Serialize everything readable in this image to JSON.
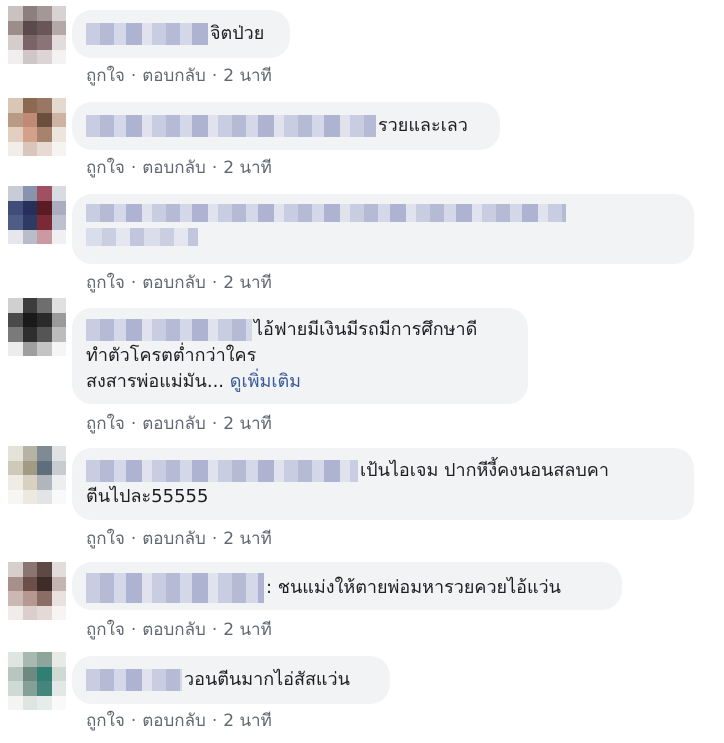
{
  "comments": [
    {
      "text": "จิตป่วย",
      "actions": {
        "like": "ถูกใจ",
        "reply": "ตอบกลับ",
        "time": "2 นาที"
      }
    },
    {
      "text": "รวยและเลว",
      "actions": {
        "like": "ถูกใจ",
        "reply": "ตอบกลับ",
        "time": "2 นาที"
      }
    },
    {
      "text": "",
      "actions": {
        "like": "ถูกใจ",
        "reply": "ตอบกลับ",
        "time": "2 นาที"
      }
    },
    {
      "text_line1": "ไอ้ฟายมีเงินมีรถมีการศึกษาดี",
      "text_line2": "ทำตัวโครตต่ำกว่าใคร",
      "text_line3": "สงสารพ่อแม่มัน...",
      "see_more": "ดูเพิ่มเติม",
      "actions": {
        "like": "ถูกใจ",
        "reply": "ตอบกลับ",
        "time": "2 นาที"
      }
    },
    {
      "text_line1": "เป้นไอเจม ปากหีงี้คงนอนสลบคา",
      "text_line2": "ตีนไปละ55555",
      "actions": {
        "like": "ถูกใจ",
        "reply": "ตอบกลับ",
        "time": "2 นาที"
      }
    },
    {
      "text": ": ชนแม่งให้ตายพ่อมหารวยควยไอ้แว่น",
      "actions": {
        "like": "ถูกใจ",
        "reply": "ตอบกลับ",
        "time": "2 นาที"
      }
    },
    {
      "text": "วอนตีนมากไอ่สัสแว่น",
      "actions": {
        "like": "ถูกใจ",
        "reply": "ตอบกลับ",
        "time": "2 นาที"
      }
    }
  ],
  "separator": "·"
}
